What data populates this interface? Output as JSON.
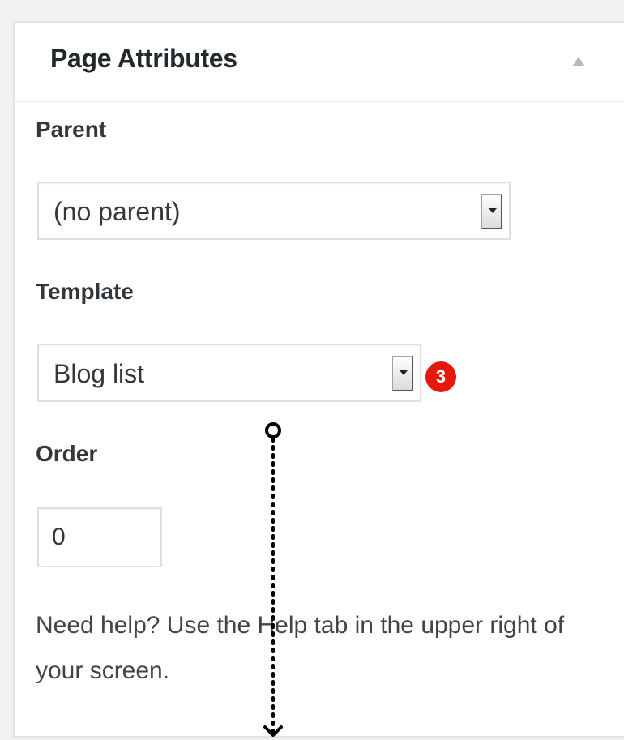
{
  "panel": {
    "title": "Page Attributes",
    "collapse_icon": "triangle-up-icon"
  },
  "parent": {
    "label": "Parent",
    "value": "(no parent)"
  },
  "template": {
    "label": "Template",
    "value": "Blog list",
    "step_badge": "3"
  },
  "order": {
    "label": "Order",
    "value": "0"
  },
  "help": {
    "text": "Need help? Use the Help tab in the upper right of your screen."
  },
  "colors": {
    "badge": "#e5170f",
    "panel_bg": "#ffffff",
    "page_bg": "#f1f1f1"
  }
}
